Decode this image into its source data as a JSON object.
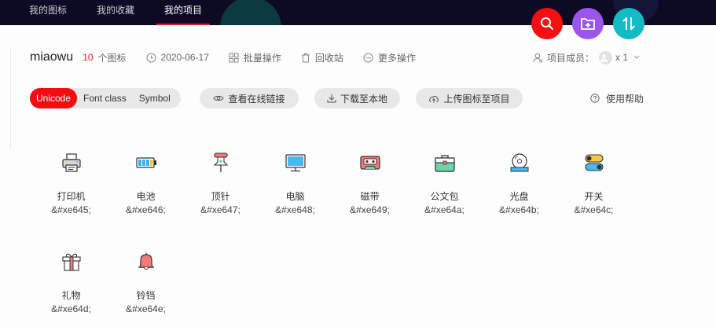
{
  "topnav": {
    "items": [
      {
        "label": "我的图标"
      },
      {
        "label": "我的收藏"
      },
      {
        "label": "我的项目"
      }
    ]
  },
  "project": {
    "name": "miaowu",
    "icon_count": "10",
    "icon_count_label": "个图标",
    "date": "2020-06-17",
    "batch_label": "批量操作",
    "trash_label": "回收站",
    "more_label": "更多操作",
    "members_label": "项目成员：",
    "members_count": "x 1"
  },
  "toolbar": {
    "tabs": [
      {
        "label": "Unicode"
      },
      {
        "label": "Font class"
      },
      {
        "label": "Symbol"
      }
    ],
    "view_link_label": "查看在线链接",
    "download_label": "下载至本地",
    "upload_label": "上传图标至项目",
    "help_label": "使用帮助"
  },
  "icons": [
    {
      "name": "打印机",
      "code": "&#xe645;",
      "icon": "printer-icon"
    },
    {
      "name": "电池",
      "code": "&#xe646;",
      "icon": "battery-icon"
    },
    {
      "name": "顶针",
      "code": "&#xe647;",
      "icon": "pushpin-icon"
    },
    {
      "name": "电脑",
      "code": "&#xe648;",
      "icon": "computer-icon"
    },
    {
      "name": "磁带",
      "code": "&#xe649;",
      "icon": "cassette-icon"
    },
    {
      "name": "公文包",
      "code": "&#xe64a;",
      "icon": "briefcase-icon"
    },
    {
      "name": "光盘",
      "code": "&#xe64b;",
      "icon": "disc-icon"
    },
    {
      "name": "开关",
      "code": "&#xe64c;",
      "icon": "switch-icon"
    },
    {
      "name": "礼物",
      "code": "&#xe64d;",
      "icon": "gift-icon"
    },
    {
      "name": "铃铛",
      "code": "&#xe64e;",
      "icon": "bell-icon"
    }
  ],
  "colors": {
    "accent": "#f20d10",
    "topbar": "#0d0a23",
    "fab_search": "#f30f12",
    "fab_add": "#9b55ee",
    "fab_sort": "#13bcc4"
  }
}
